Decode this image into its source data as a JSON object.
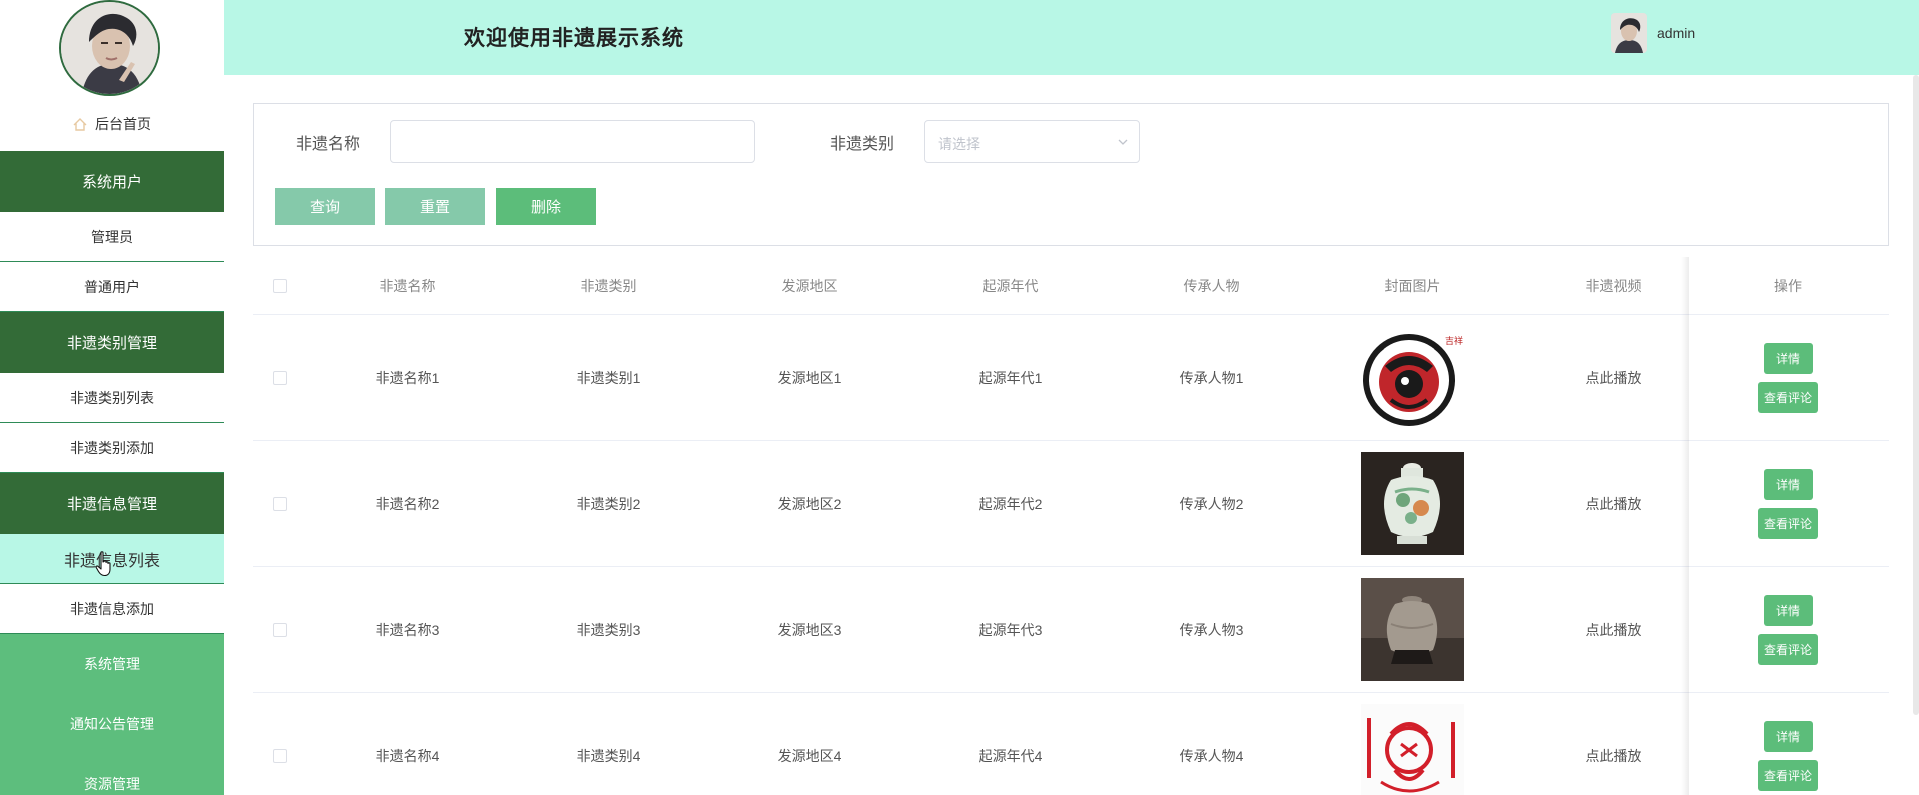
{
  "header": {
    "title": "欢迎使用非遗展示系统",
    "username": "admin"
  },
  "sidebar": {
    "home": "后台首页",
    "groups": [
      {
        "label": "系统用户",
        "items": [
          "管理员",
          "普通用户"
        ]
      },
      {
        "label": "非遗类别管理",
        "items": [
          "非遗类别列表",
          "非遗类别添加"
        ]
      },
      {
        "label": "非遗信息管理",
        "items": [
          "非遗信息列表",
          "非遗信息添加"
        ]
      }
    ],
    "active_item": "非遗信息列表",
    "flat_items": [
      "系统管理",
      "通知公告管理",
      "资源管理"
    ]
  },
  "search": {
    "name_label": "非遗名称",
    "name_value": "",
    "type_label": "非遗类别",
    "type_placeholder": "请选择",
    "query_button": "查询",
    "reset_button": "重置",
    "delete_button": "删除"
  },
  "table": {
    "columns": [
      "非遗名称",
      "非遗类别",
      "发源地区",
      "起源年代",
      "传承人物",
      "封面图片",
      "非遗视频",
      "操作"
    ],
    "detail_button": "详情",
    "comment_button": "查看评论",
    "rows": [
      {
        "name": "非遗名称1",
        "type": "非遗类别1",
        "region": "发源地区1",
        "era": "起源年代1",
        "person": "传承人物1",
        "video": "点此播放",
        "cover": "paper-cut-dragon"
      },
      {
        "name": "非遗名称2",
        "type": "非遗类别2",
        "region": "发源地区2",
        "era": "起源年代2",
        "person": "传承人物2",
        "video": "点此播放",
        "cover": "porcelain-jar"
      },
      {
        "name": "非遗名称3",
        "type": "非遗类别3",
        "region": "发源地区3",
        "era": "起源年代3",
        "person": "传承人物3",
        "video": "点此播放",
        "cover": "clay-pot"
      },
      {
        "name": "非遗名称4",
        "type": "非遗类别4",
        "region": "发源地区4",
        "era": "起源年代4",
        "person": "传承人物4",
        "video": "点此播放",
        "cover": "red-paper-cut"
      }
    ]
  },
  "colors": {
    "topbar": "#b8f7e6",
    "sidebar_group": "#336b37",
    "sidebar_flat": "#5dbe7d",
    "button_primary": "#5cbd7a",
    "button_light": "#85c9aa"
  }
}
